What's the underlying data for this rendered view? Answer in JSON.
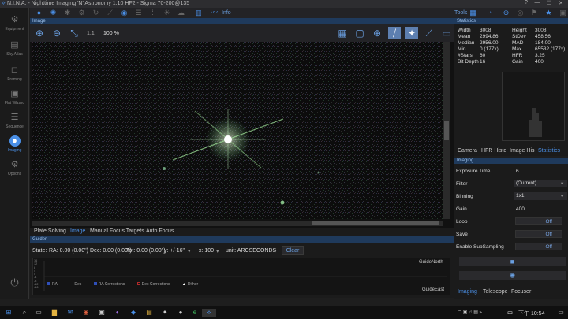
{
  "window": {
    "title": "N.I.N.A. - Nighttime Imaging 'N' Astronomy 1.10 HF2  -  Sigma 70-200@135",
    "min": "—",
    "max": "☐",
    "close": "✕",
    "help": "?"
  },
  "leftnav": [
    {
      "label": "Equipment",
      "icon": "equipment-icon",
      "glyph": "⚙"
    },
    {
      "label": "Sky Atlas",
      "icon": "sky-atlas-icon",
      "glyph": "▤"
    },
    {
      "label": "Framing",
      "icon": "framing-icon",
      "glyph": "◻"
    },
    {
      "label": "Flat Wizard",
      "icon": "flat-wizard-icon",
      "glyph": "▣"
    },
    {
      "label": "Sequence",
      "icon": "sequence-icon",
      "glyph": "☰"
    },
    {
      "label": "Imaging",
      "icon": "imaging-icon",
      "glyph": "●"
    },
    {
      "label": "Options",
      "icon": "options-icon",
      "glyph": "⚙"
    }
  ],
  "toolbar": {
    "info_label": "Info",
    "tools_label": "Tools"
  },
  "image_panel": {
    "header": "Image",
    "zoom": "100 %",
    "onetoone": "1:1"
  },
  "image_tabs": [
    "Plate Solving",
    "Image",
    "Manual Focus Targets",
    "Auto Focus"
  ],
  "guider": {
    "header": "Guider",
    "state_label": "State:",
    "ra": "RA: 0.00 (0.00\")",
    "dec": "Dec: 0.00 (0.00\")",
    "tot": "Tot: 0.00 (0.00\")",
    "y_scale": "y: +/-16\"",
    "x_scale": "x: 100",
    "unit": "unit: ARCSECONDS",
    "clear": "Clear",
    "y_ticks": [
      "16",
      "12",
      "8",
      "4",
      "0",
      "-4",
      "-8",
      "-12",
      "-16"
    ],
    "north": "GuideNorth",
    "east": "GuideEast",
    "legend": [
      {
        "label": "RA",
        "color": "#2f4fb8"
      },
      {
        "label": "Dec",
        "color": "#b02a2a"
      },
      {
        "label": "RA Corrections",
        "color": "#2f4fb8"
      },
      {
        "label": "Dec Corrections",
        "color": "#b02a2a"
      },
      {
        "label": "Dither",
        "color": "#ffffff"
      }
    ]
  },
  "statistics": {
    "header": "Statistics",
    "rows": [
      [
        "Width",
        "3008",
        "Height",
        "3008"
      ],
      [
        "Mean",
        "2994.86",
        "StDev",
        "458.56"
      ],
      [
        "Median",
        "2956.00",
        "MAD",
        "184.00"
      ],
      [
        "Min",
        "0 (177x)",
        "Max",
        "65532 (177x)"
      ],
      [
        "#Stars",
        "60",
        "HFR",
        "3.25"
      ],
      [
        "Bit Depth",
        "16",
        "Gain",
        "400"
      ]
    ],
    "tabs": [
      "Camera",
      "HFR Histo",
      "Image His",
      "Statistics"
    ]
  },
  "imaging": {
    "header": "Imaging",
    "exposure_label": "Exposure Time",
    "exposure": "6",
    "filter_label": "Filter",
    "filter": "(Current)",
    "binning_label": "Binning",
    "binning": "1x1",
    "gain_label": "Gain",
    "gain": "400",
    "loop_label": "Loop",
    "loop": "Off",
    "save_label": "Save",
    "save": "Off",
    "subsampling_label": "Enable SubSampling",
    "subsampling": "Off",
    "tabs": [
      "Imaging",
      "Telescope",
      "Focuser"
    ]
  },
  "taskbar": {
    "clock": "下午 10:54",
    "lang": "中"
  }
}
